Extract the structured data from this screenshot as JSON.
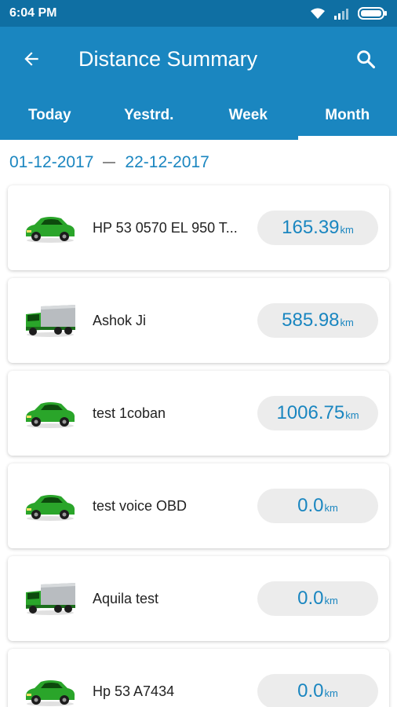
{
  "status_bar": {
    "time": "6:04 PM"
  },
  "app_bar": {
    "title": "Distance Summary"
  },
  "tabs": [
    {
      "label": "Today",
      "active": false
    },
    {
      "label": "Yestrd.",
      "active": false
    },
    {
      "label": "Week",
      "active": false
    },
    {
      "label": "Month",
      "active": true
    }
  ],
  "date_range": {
    "start": "01-12-2017",
    "end": "22-12-2017"
  },
  "vehicles": [
    {
      "name": "HP 53 0570 EL 950 T...",
      "distance": "165.39",
      "unit": "km",
      "type": "car-icon"
    },
    {
      "name": "Ashok Ji",
      "distance": "585.98",
      "unit": "km",
      "type": "truck-icon"
    },
    {
      "name": "test 1coban",
      "distance": "1006.75",
      "unit": "km",
      "type": "car-icon"
    },
    {
      "name": "test voice OBD",
      "distance": "0.0",
      "unit": "km",
      "type": "car-icon"
    },
    {
      "name": "Aquila test",
      "distance": "0.0",
      "unit": "km",
      "type": "truck-icon"
    },
    {
      "name": "Hp 53 A7434",
      "distance": "0.0",
      "unit": "km",
      "type": "car-icon"
    }
  ],
  "colors": {
    "primary": "#1a86c0",
    "status_bar": "#0f6fa3",
    "vehicle_green": "#2aa52a",
    "truck_cargo": "#b8bcc0"
  }
}
